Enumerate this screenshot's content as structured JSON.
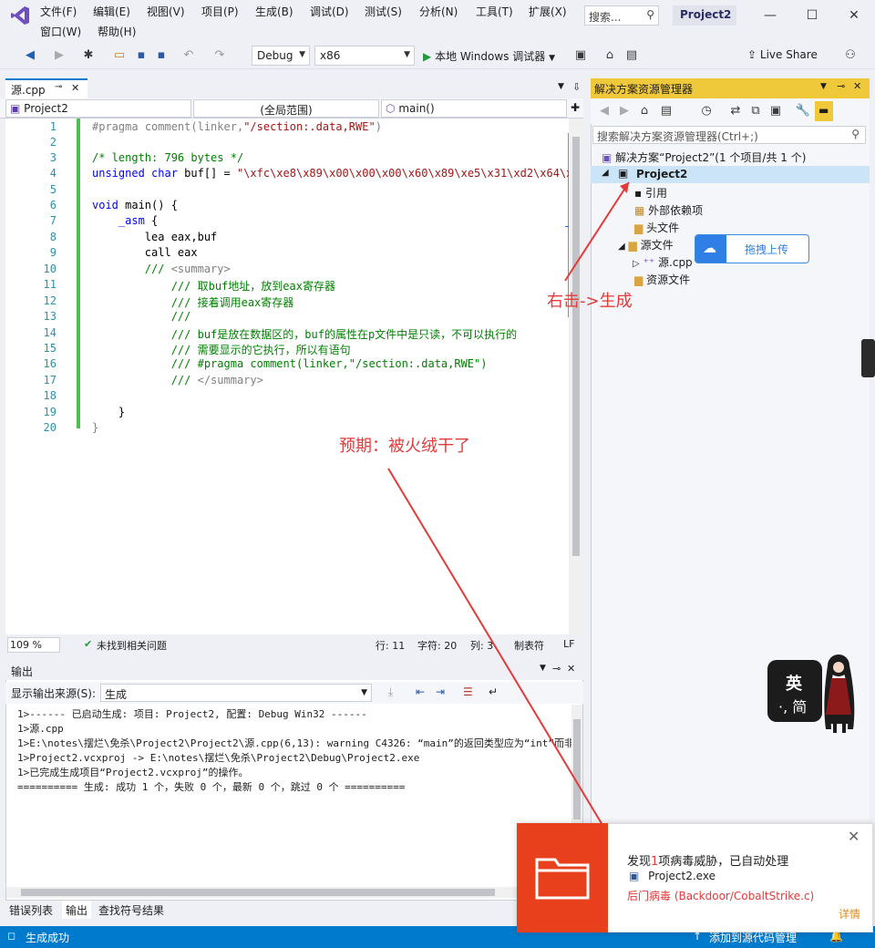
{
  "menu": {
    "items": [
      "文件(F)",
      "编辑(E)",
      "视图(V)",
      "项目(P)",
      "生成(B)",
      "调试(D)",
      "测试(S)",
      "分析(N)",
      "工具(T)",
      "扩展(X)"
    ],
    "row2": [
      "窗口(W)",
      "帮助(H)"
    ],
    "search_placeholder": "搜索...",
    "project_name": "Project2"
  },
  "toolbar": {
    "config": "Debug",
    "platform": "x86",
    "run_label": "本地 Windows 调试器",
    "live_share": "Live Share"
  },
  "editor": {
    "tab_label": "源.cpp",
    "nav_project": "Project2",
    "nav_scope": "(全局范围)",
    "nav_function": "main()",
    "zoom": "109 %",
    "issues": "未找到相关问题",
    "row": "行: 11",
    "char": "字符: 20",
    "col": "列: 3",
    "tabs": "制表符",
    "eol": "LF",
    "line_numbers": [
      "1",
      "2",
      "3",
      "4",
      "5",
      "6",
      "7",
      "8",
      "9",
      "10",
      "11",
      "12",
      "13",
      "14",
      "15",
      "16",
      "17",
      "18",
      "19",
      "20"
    ]
  },
  "output": {
    "title": "输出",
    "source_label": "显示输出来源(S):",
    "source_value": "生成",
    "lines": [
      "1>------ 已启动生成: 项目: Project2, 配置: Debug Win32 ------",
      "1>源.cpp",
      "1>E:\\notes\\摆烂\\免杀\\Project2\\Project2\\源.cpp(6,13): warning C4326: “main”的返回类型应为“int”而非",
      "1>Project2.vcxproj -> E:\\notes\\摆烂\\免杀\\Project2\\Debug\\Project2.exe",
      "1>已完成生成项目“Project2.vcxproj”的操作。",
      "========== 生成: 成功 1 个，失败 0 个，最新 0 个，跳过 0 个 =========="
    ]
  },
  "bottom_tabs": [
    "错误列表",
    "输出",
    "查找符号结果"
  ],
  "statusbar": {
    "left": "生成成功",
    "right": "添加到源代码管理"
  },
  "solution_explorer": {
    "title": "解决方案资源管理器",
    "search_placeholder": "搜索解决方案资源管理器(Ctrl+;)",
    "solution": "解决方案“Project2”(1 个项目/共 1 个)",
    "project": "Project2",
    "items": [
      "引用",
      "外部依赖项",
      "头文件",
      "源文件",
      "源.cpp",
      "资源文件"
    ]
  },
  "upload_bubble": "拖拽上传",
  "annotations": {
    "right_click": "右击->生成",
    "expected": "预期：被火绒干了"
  },
  "av_popup": {
    "title_prefix": "发现",
    "title_count": "1",
    "title_suffix": "项病毒威胁，已自动处理",
    "file": "Project2.exe",
    "threat": "后门病毒 (Backdoor/CobaltStrike.c)",
    "details": "详情"
  },
  "mascot": {
    "line1": "英",
    "line2": "·, 简"
  }
}
